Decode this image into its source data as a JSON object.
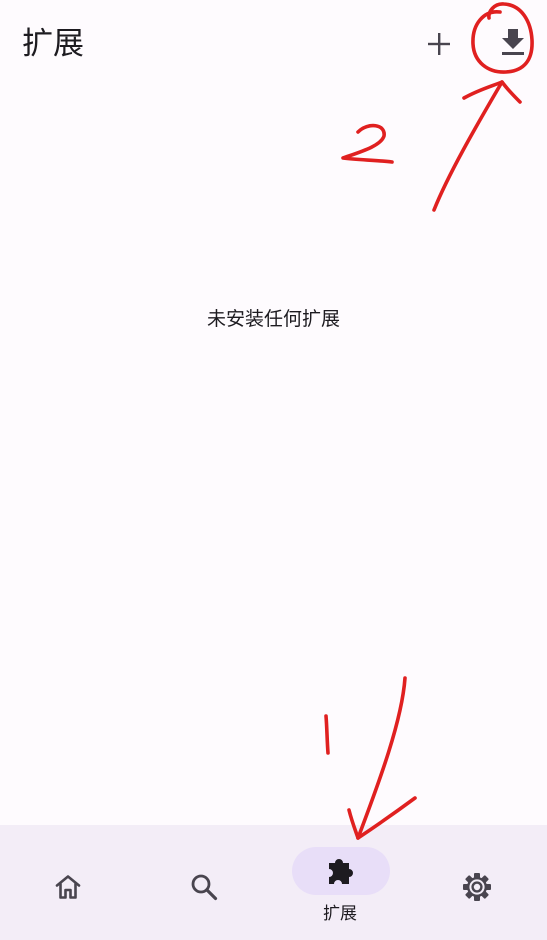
{
  "header": {
    "title": "扩展",
    "actions": [
      {
        "name": "add",
        "icon": "plus-icon"
      },
      {
        "name": "download",
        "icon": "download-icon"
      }
    ]
  },
  "main": {
    "empty_message": "未安装任何扩展"
  },
  "bottom_nav": {
    "active_index": 2,
    "items": [
      {
        "name": "home",
        "icon": "home-icon",
        "label": ""
      },
      {
        "name": "search",
        "icon": "search-icon",
        "label": ""
      },
      {
        "name": "extensions",
        "icon": "puzzle-icon",
        "label": "扩展"
      },
      {
        "name": "settings",
        "icon": "gear-icon",
        "label": ""
      }
    ]
  },
  "annotations": {
    "marker_1": "1",
    "marker_2": "2",
    "color": "#E02020"
  },
  "colors": {
    "background": "#FEFBFE",
    "nav_background": "#F3EDF7",
    "active_pill": "#E8DEF8",
    "text": "#1D1B20",
    "icon": "#49454F"
  }
}
